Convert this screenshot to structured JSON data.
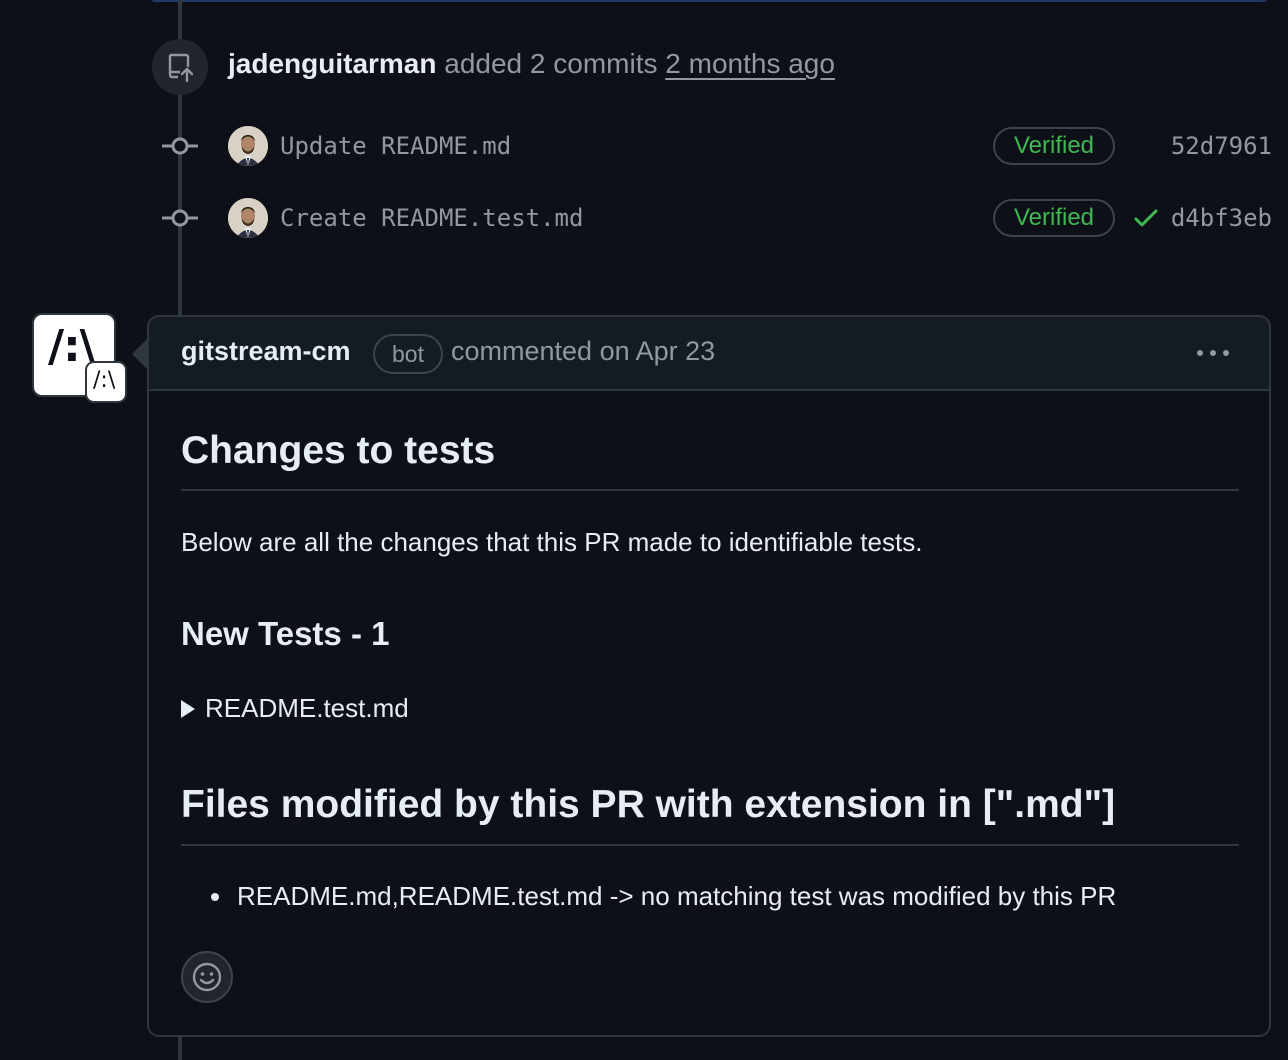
{
  "event": {
    "actor": "jadenguitarman",
    "action": "added 2 commits",
    "time": "2 months ago",
    "icon": "repo-push-icon"
  },
  "commits": [
    {
      "message": "Update README.md",
      "badge": "Verified",
      "sha": "52d7961",
      "status_icon": ""
    },
    {
      "message": "Create README.test.md",
      "badge": "Verified",
      "sha": "d4bf3eb",
      "status_icon": "check-icon"
    }
  ],
  "comment": {
    "author": "gitstream-cm",
    "author_label": "bot",
    "meta": "commented on Apr 23",
    "heading1": "Changes to tests",
    "paragraph": "Below are all the changes that this PR made to identifiable tests.",
    "heading2": "New Tests - 1",
    "details_summary": "README.test.md",
    "heading3": "Files modified by this PR with extension in [\".md\"]",
    "list_items": [
      "README.md,README.test.md -> no matching test was modified by this PR"
    ]
  },
  "colors": {
    "background": "#0d1117",
    "verified": "#3fb950",
    "muted": "#9198a1",
    "border": "#30363d"
  }
}
